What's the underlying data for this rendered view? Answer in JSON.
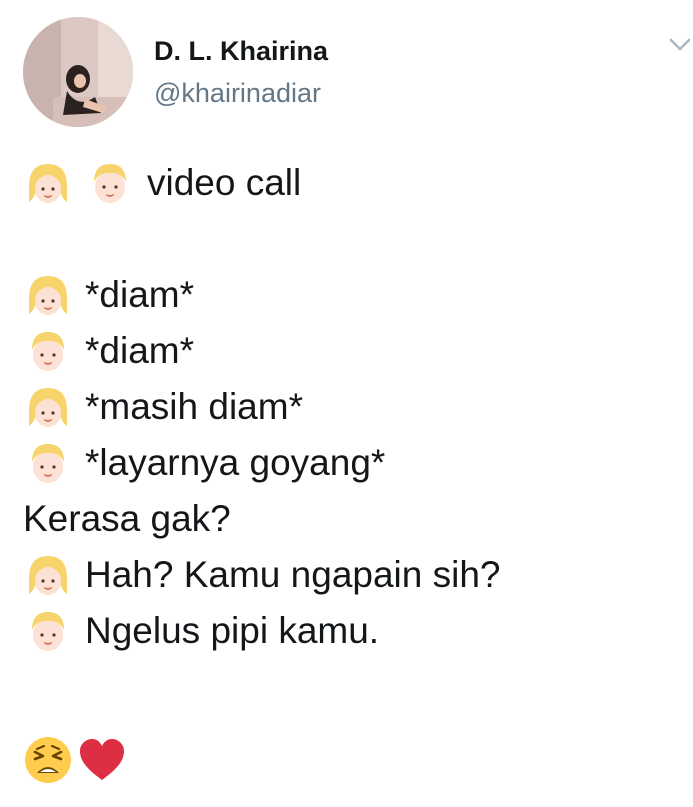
{
  "tweet": {
    "author": {
      "display_name": "D. L. Khairina",
      "handle": "@khairinadiar"
    },
    "lines": [
      {
        "emojis": [
          "blonde-girl-emoji",
          "blonde-boy-emoji"
        ],
        "text": "video call"
      },
      {
        "emojis": [],
        "text": ""
      },
      {
        "emojis": [
          "blonde-girl-emoji"
        ],
        "text": "*diam*"
      },
      {
        "emojis": [
          "blonde-boy-emoji"
        ],
        "text": "*diam*"
      },
      {
        "emojis": [
          "blonde-girl-emoji"
        ],
        "text": "*masih diam*"
      },
      {
        "emojis": [
          "blonde-boy-emoji"
        ],
        "text": "*layarnya goyang*"
      },
      {
        "emojis": [],
        "text": "Kerasa gak?"
      },
      {
        "emojis": [
          "blonde-girl-emoji"
        ],
        "text": "Hah? Kamu ngapain sih?"
      },
      {
        "emojis": [
          "blonde-boy-emoji"
        ],
        "text": "Ngelus pipi kamu."
      },
      {
        "emojis": [],
        "text": ""
      }
    ],
    "closing_emojis": [
      "weary-face-emoji",
      "red-heart-emoji"
    ]
  },
  "icons": {
    "caret": "chevron-down-icon"
  },
  "colors": {
    "text": "#14171a",
    "handle": "#657786",
    "caret": "#aab8c2",
    "heart": "#dd2e44",
    "weary": "#ffcc4d"
  }
}
